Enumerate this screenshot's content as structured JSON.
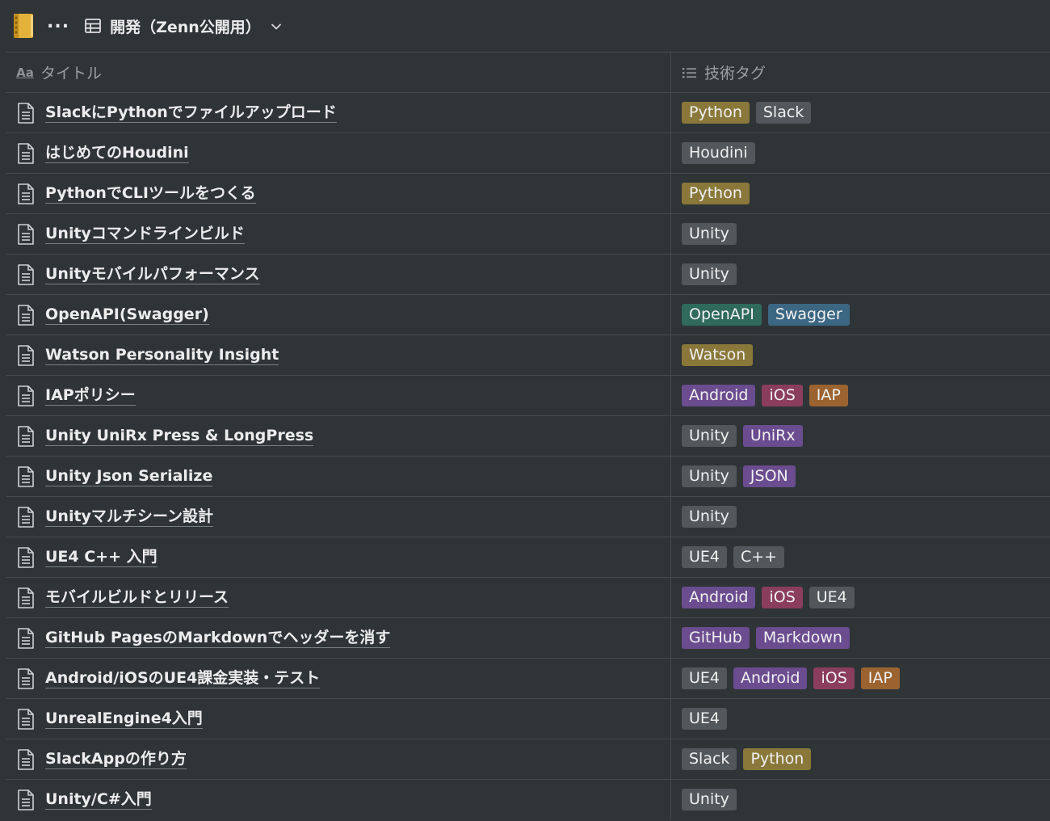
{
  "header": {
    "more_label": "...",
    "db_title": "開発（Zenn公開用）"
  },
  "columns": {
    "title": "タイトル",
    "tags": "技術タグ"
  },
  "tag_colors": {
    "yellow": "#89783a",
    "gray": "#51575b",
    "green": "#2f6a5b",
    "blue": "#3c6783",
    "purple": "#6a4c8f",
    "pink": "#8b3d5e",
    "orange": "#9b6330"
  },
  "rows": [
    {
      "title": "SlackにPythonでファイルアップロード",
      "tags": [
        {
          "label": "Python",
          "color": "yellow"
        },
        {
          "label": "Slack",
          "color": "gray"
        }
      ]
    },
    {
      "title": "はじめてのHoudini",
      "tags": [
        {
          "label": "Houdini",
          "color": "gray"
        }
      ]
    },
    {
      "title": "PythonでCLIツールをつくる",
      "tags": [
        {
          "label": "Python",
          "color": "yellow"
        }
      ]
    },
    {
      "title": "Unityコマンドラインビルド",
      "tags": [
        {
          "label": "Unity",
          "color": "gray"
        }
      ]
    },
    {
      "title": "Unityモバイルパフォーマンス",
      "tags": [
        {
          "label": "Unity",
          "color": "gray"
        }
      ]
    },
    {
      "title": "OpenAPI(Swagger)",
      "tags": [
        {
          "label": "OpenAPI",
          "color": "green"
        },
        {
          "label": "Swagger",
          "color": "blue"
        }
      ]
    },
    {
      "title": "Watson Personality Insight",
      "tags": [
        {
          "label": "Watson",
          "color": "yellow"
        }
      ]
    },
    {
      "title": "IAPポリシー",
      "tags": [
        {
          "label": "Android",
          "color": "purple"
        },
        {
          "label": "iOS",
          "color": "pink"
        },
        {
          "label": "IAP",
          "color": "orange"
        }
      ]
    },
    {
      "title": "Unity UniRx Press & LongPress",
      "tags": [
        {
          "label": "Unity",
          "color": "gray"
        },
        {
          "label": "UniRx",
          "color": "purple"
        }
      ]
    },
    {
      "title": "Unity Json Serialize",
      "tags": [
        {
          "label": "Unity",
          "color": "gray"
        },
        {
          "label": "JSON",
          "color": "purple"
        }
      ]
    },
    {
      "title": "Unityマルチシーン設計",
      "tags": [
        {
          "label": "Unity",
          "color": "gray"
        }
      ]
    },
    {
      "title": "UE4 C++ 入門",
      "tags": [
        {
          "label": "UE4",
          "color": "gray"
        },
        {
          "label": "C++",
          "color": "gray"
        }
      ]
    },
    {
      "title": "モバイルビルドとリリース",
      "tags": [
        {
          "label": "Android",
          "color": "purple"
        },
        {
          "label": "iOS",
          "color": "pink"
        },
        {
          "label": "UE4",
          "color": "gray"
        }
      ]
    },
    {
      "title": "GitHub PagesのMarkdownでヘッダーを消す",
      "tags": [
        {
          "label": "GitHub",
          "color": "purple"
        },
        {
          "label": "Markdown",
          "color": "purple"
        }
      ]
    },
    {
      "title": "Android/iOSのUE4課金実装・テスト",
      "tags": [
        {
          "label": "UE4",
          "color": "gray"
        },
        {
          "label": "Android",
          "color": "purple"
        },
        {
          "label": "iOS",
          "color": "pink"
        },
        {
          "label": "IAP",
          "color": "orange"
        }
      ]
    },
    {
      "title": "UnrealEngine4入門",
      "tags": [
        {
          "label": "UE4",
          "color": "gray"
        }
      ]
    },
    {
      "title": "SlackAppの作り方",
      "tags": [
        {
          "label": "Slack",
          "color": "gray"
        },
        {
          "label": "Python",
          "color": "yellow"
        }
      ]
    },
    {
      "title": "Unity/C#入門",
      "tags": [
        {
          "label": "Unity",
          "color": "gray"
        }
      ]
    }
  ]
}
